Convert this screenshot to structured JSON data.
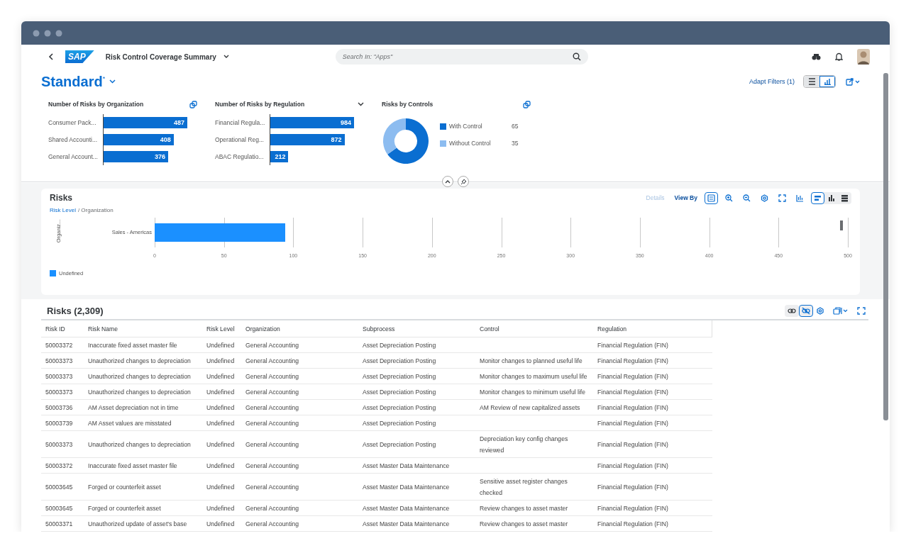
{
  "header": {
    "logo": "SAP",
    "title": "Risk Control Coverage Summary",
    "search": {
      "placeholder": "Search In: \"Apps\""
    }
  },
  "variant": {
    "name": "Standard",
    "marker": "*"
  },
  "filter_bar": {
    "adapt_filters": "Adapt Filters (1)",
    "toggles": [
      {
        "kind": "compact",
        "selected": false
      },
      {
        "kind": "visual",
        "selected": true
      }
    ]
  },
  "kpi_cards": [
    {
      "title": "Number of Risks by Organization",
      "dropdown": false,
      "chart_data": {
        "type": "bar",
        "orientation": "horizontal",
        "categories": [
          "Consumer Pack...",
          "Shared Accounti...",
          "General Account..."
        ],
        "values": [
          487,
          408,
          376
        ],
        "data_labels": true
      }
    },
    {
      "title": "Number of Risks by Regulation",
      "dropdown": true,
      "chart_data": {
        "type": "bar",
        "orientation": "horizontal",
        "categories": [
          "Financial Regula...",
          "Operational Reg...",
          "ABAC Regulatio..."
        ],
        "values": [
          984,
          872,
          212
        ],
        "data_labels": true
      }
    },
    {
      "title": "Risks by Controls",
      "dropdown": false,
      "chart_data": {
        "type": "donut",
        "categories": [
          "With Control",
          "Without Control"
        ],
        "values": [
          65,
          35
        ],
        "data_labels": true,
        "legend": "right"
      }
    }
  ],
  "risks_chart": {
    "title": "Risks",
    "details": "Details",
    "details_disabled": true,
    "view_by": "View By",
    "breadcrumb": {
      "link": "Risk Level",
      "rest": "/ Organization"
    },
    "tools": [
      {
        "kind": "legend",
        "selected": true
      },
      {
        "kind": "zoom-in",
        "selected": false
      },
      {
        "kind": "zoom-out",
        "selected": false
      },
      {
        "kind": "settings",
        "selected": false
      },
      {
        "kind": "fullscreen",
        "selected": false
      },
      {
        "kind": "chart-type",
        "selected": false
      }
    ],
    "views": [
      {
        "kind": "bar",
        "selected": true
      },
      {
        "kind": "column",
        "selected": false
      },
      {
        "kind": "table",
        "selected": false
      }
    ],
    "chart_data": {
      "type": "bar",
      "orientation": "horizontal",
      "ylabel": "Organiz...",
      "categories": [
        "Sales - Americas"
      ],
      "series": [
        {
          "name": "Undefined",
          "color": "#1b90ff",
          "values": [
            94
          ]
        }
      ],
      "xlim": [
        0,
        500
      ],
      "xticks": [
        0,
        50,
        100,
        150,
        200,
        250,
        300,
        350,
        400,
        450,
        500
      ]
    }
  },
  "table": {
    "title": "Risks (2,309)",
    "tools": [
      {
        "kind": "link",
        "selected": false
      },
      {
        "kind": "unlink",
        "selected": true
      },
      {
        "kind": "settings",
        "selected": false
      },
      {
        "kind": "export",
        "selected": false
      },
      {
        "kind": "fullscreen",
        "selected": false
      }
    ],
    "columns": [
      "Risk ID",
      "Risk Name",
      "Risk Level",
      "Organization",
      "Subprocess",
      "Control",
      "Regulation"
    ],
    "rows": [
      {
        "id": "50003372",
        "name": "Inaccurate fixed asset master file",
        "level": "Undefined",
        "organization": "General Accounting",
        "subprocess": "Asset Depreciation Posting",
        "regulation": "Financial Regulation (FIN)"
      },
      {
        "id": "50003373",
        "name": "Unauthorized changes to depreciation",
        "level": "Undefined",
        "organization": "General Accounting",
        "subprocess": "Asset Depreciation Posting",
        "control": "Monitor changes to planned useful life",
        "regulation": "Financial Regulation (FIN)"
      },
      {
        "id": "50003373",
        "name": "Unauthorized changes to depreciation",
        "level": "Undefined",
        "organization": "General Accounting",
        "subprocess": "Asset Depreciation Posting",
        "control": "Monitor changes to maximum useful life",
        "regulation": "Financial Regulation (FIN)"
      },
      {
        "id": "50003373",
        "name": "Unauthorized changes to depreciation",
        "level": "Undefined",
        "organization": "General Accounting",
        "subprocess": "Asset Depreciation Posting",
        "control": "Monitor changes to minimum useful life",
        "regulation": "Financial Regulation (FIN)"
      },
      {
        "id": "50003736",
        "name": "AM Asset depreciation not in time",
        "level": "Undefined",
        "organization": "General Accounting",
        "subprocess": "Asset Depreciation Posting",
        "control": "AM Review of new capitalized assets",
        "regulation": "Financial Regulation (FIN)"
      },
      {
        "id": "50003739",
        "name": "AM Asset values are misstated",
        "level": "Undefined",
        "organization": "General Accounting",
        "subprocess": "Asset Depreciation Posting",
        "regulation": "Financial Regulation (FIN)"
      },
      {
        "id": "50003373",
        "name": "Unauthorized changes to depreciation",
        "level": "Undefined",
        "organization": "General Accounting",
        "subprocess": "Asset Depreciation Posting",
        "control": "Depreciation key config changes reviewed",
        "regulation": "Financial Regulation (FIN)"
      },
      {
        "id": "50003372",
        "name": "Inaccurate fixed asset master file",
        "level": "Undefined",
        "organization": "General Accounting",
        "subprocess": "Asset Master Data Maintenance",
        "regulation": "Financial Regulation (FIN)"
      },
      {
        "id": "50003645",
        "name": "Forged or counterfeit asset",
        "level": "Undefined",
        "organization": "General Accounting",
        "subprocess": "Asset Master Data Maintenance",
        "control": "Sensitive asset register changes checked",
        "regulation": "Financial Regulation (FIN)"
      },
      {
        "id": "50003645",
        "name": "Forged or counterfeit asset",
        "level": "Undefined",
        "organization": "General Accounting",
        "subprocess": "Asset Master Data Maintenance",
        "control": "Review changes to asset master",
        "regulation": "Financial Regulation (FIN)"
      },
      {
        "id": "50003371",
        "name": "Unauthorized update of asset's base",
        "level": "Undefined",
        "organization": "General Accounting",
        "subprocess": "Asset Master Data Maintenance",
        "control": "Review changes to asset master",
        "regulation": "Financial Regulation (FIN)"
      }
    ]
  }
}
